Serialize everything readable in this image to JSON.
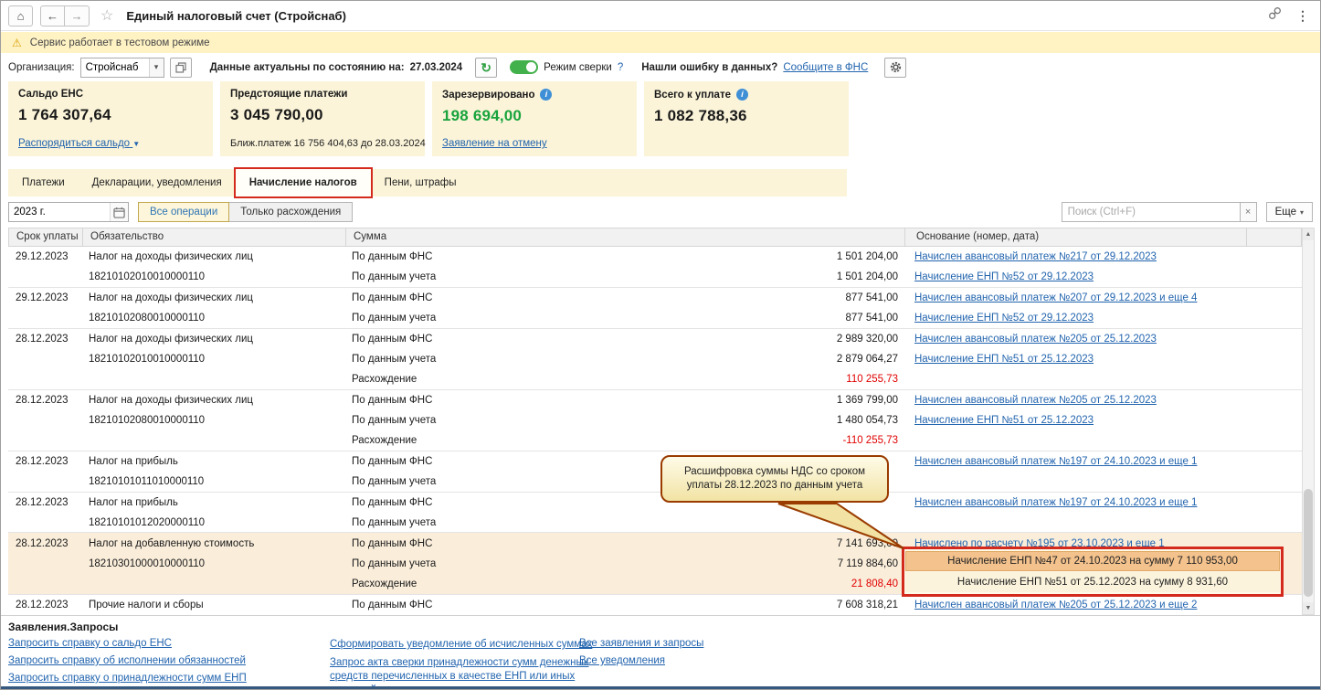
{
  "titlebar": {
    "title": "Единый налоговый счет (Стройснаб)"
  },
  "warning": {
    "text": "Сервис работает в тестовом режиме"
  },
  "toolbar": {
    "org_label": "Организация:",
    "org_value": "Стройснаб",
    "actuality_label": "Данные актуальны по состоянию на:",
    "actuality_date": "27.03.2024",
    "reconcile_label": "Режим сверки",
    "reconcile_help": "?",
    "error_prompt": "Нашли ошибку в данных?",
    "error_link": "Сообщите в ФНС"
  },
  "summary": {
    "balance": {
      "title": "Сальдо ЕНС",
      "value": "1 764 307,64",
      "link": "Распорядиться сальдо"
    },
    "upcoming": {
      "title": "Предстоящие платежи",
      "value": "3 045 790,00",
      "note": "Ближ.платеж 16 756 404,63 до 28.03.2024"
    },
    "reserved": {
      "title": "Зарезервировано",
      "value": "198 694,00",
      "link": "Заявление на отмену"
    },
    "total": {
      "title": "Всего к уплате",
      "value": "1 082 788,36"
    }
  },
  "tabs": {
    "payments": "Платежи",
    "declarations": "Декларации, уведомления",
    "accruals": "Начисление налогов",
    "penalties": "Пени, штрафы"
  },
  "filters": {
    "year": "2023 г.",
    "all_operations": "Все операции",
    "only_discrepancies": "Только расхождения",
    "search_placeholder": "Поиск (Ctrl+F)",
    "more": "Еще"
  },
  "table": {
    "headers": {
      "due": "Срок уплаты",
      "obligation": "Обязательство",
      "amount": "Сумма",
      "basis": "Основание (номер, дата)"
    },
    "rows": [
      {
        "date": "29.12.2023",
        "obligation": "Налог на доходы физических лиц",
        "kind": "По данным ФНС",
        "amount": "1 501 204,00",
        "red": false,
        "basis": "Начислен авансовый платеж №217 от 29.12.2023",
        "selected": false,
        "group_end": false
      },
      {
        "date": "",
        "obligation": "18210102010010000110",
        "kind": "По данным учета",
        "amount": "1 501 204,00",
        "red": false,
        "basis": "Начисление ЕНП №52 от 29.12.2023",
        "selected": false,
        "group_end": true
      },
      {
        "date": "29.12.2023",
        "obligation": "Налог на доходы физических лиц",
        "kind": "По данным ФНС",
        "amount": "877 541,00",
        "red": false,
        "basis": "Начислен авансовый платеж №207 от 29.12.2023 и еще 4",
        "selected": false,
        "group_end": false
      },
      {
        "date": "",
        "obligation": "18210102080010000110",
        "kind": "По данным учета",
        "amount": "877 541,00",
        "red": false,
        "basis": "Начисление ЕНП №52 от 29.12.2023",
        "selected": false,
        "group_end": true
      },
      {
        "date": "28.12.2023",
        "obligation": "Налог на доходы физических лиц",
        "kind": "По данным ФНС",
        "amount": "2 989 320,00",
        "red": false,
        "basis": "Начислен авансовый платеж №205 от 25.12.2023",
        "selected": false,
        "group_end": false
      },
      {
        "date": "",
        "obligation": "18210102010010000110",
        "kind": "По данным учета",
        "amount": "2 879 064,27",
        "red": false,
        "basis": "Начисление ЕНП №51 от 25.12.2023",
        "selected": false,
        "group_end": false
      },
      {
        "date": "",
        "obligation": "",
        "kind": "Расхождение",
        "amount": "110 255,73",
        "red": true,
        "basis": "",
        "selected": false,
        "group_end": true
      },
      {
        "date": "28.12.2023",
        "obligation": "Налог на доходы физических лиц",
        "kind": "По данным ФНС",
        "amount": "1 369 799,00",
        "red": false,
        "basis": "Начислен авансовый платеж №205 от 25.12.2023",
        "selected": false,
        "group_end": false
      },
      {
        "date": "",
        "obligation": "18210102080010000110",
        "kind": "По данным учета",
        "amount": "1 480 054,73",
        "red": false,
        "basis": "Начисление ЕНП №51 от 25.12.2023",
        "selected": false,
        "group_end": false
      },
      {
        "date": "",
        "obligation": "",
        "kind": "Расхождение",
        "amount": "-110 255,73",
        "red": true,
        "basis": "",
        "selected": false,
        "group_end": true
      },
      {
        "date": "28.12.2023",
        "obligation": "Налог на прибыль",
        "kind": "По данным ФНС",
        "amount": "",
        "red": false,
        "basis": "Начислен авансовый платеж №197 от 24.10.2023 и еще 1",
        "selected": false,
        "group_end": false
      },
      {
        "date": "",
        "obligation": "18210101011010000110",
        "kind": "По данным учета",
        "amount": "",
        "red": false,
        "basis": "",
        "selected": false,
        "group_end": true
      },
      {
        "date": "28.12.2023",
        "obligation": "Налог на прибыль",
        "kind": "По данным ФНС",
        "amount": "",
        "red": false,
        "basis": "Начислен авансовый платеж №197 от 24.10.2023 и еще 1",
        "selected": false,
        "group_end": false
      },
      {
        "date": "",
        "obligation": "18210101012020000110",
        "kind": "По данным учета",
        "amount": "",
        "red": false,
        "basis": "",
        "selected": false,
        "group_end": true
      },
      {
        "date": "28.12.2023",
        "obligation": "Налог на добавленную стоимость",
        "kind": "По данным ФНС",
        "amount": "7 141 693,00",
        "red": false,
        "basis": "Начислено по расчету №195 от 23.10.2023 и еще 1",
        "selected": true,
        "group_end": false
      },
      {
        "date": "",
        "obligation": "18210301000010000110",
        "kind": "По данным учета",
        "amount": "7 119 884,60",
        "red": false,
        "basis": "",
        "selected": true,
        "group_end": false
      },
      {
        "date": "",
        "obligation": "",
        "kind": "Расхождение",
        "amount": "21 808,40",
        "red": true,
        "basis": "",
        "selected": true,
        "group_end": true
      },
      {
        "date": "28.12.2023",
        "obligation": "Прочие налоги и сборы",
        "kind": "По данным ФНС",
        "amount": "7 608 318,21",
        "red": false,
        "basis": "Начислен авансовый платеж №205 от 25.12.2023 и еще 2",
        "selected": false,
        "group_end": false
      }
    ]
  },
  "callout": {
    "text": "Расшифровка суммы НДС со сроком уплаты 28.12.2023 по данным учета"
  },
  "popup": {
    "items": [
      {
        "text": "Начисление ЕНП №47 от 24.10.2023 на сумму 7 110 953,00",
        "highlighted": true
      },
      {
        "text": "Начисление ЕНП №51 от 25.12.2023 на сумму 8 931,60",
        "highlighted": false
      }
    ]
  },
  "requests": {
    "title": "Заявления.Запросы",
    "col1": [
      "Запросить справку о сальдо ЕНС",
      "Запросить справку об исполнении обязанностей",
      "Запросить справку о принадлежности сумм ЕНП"
    ],
    "col2": [
      "Сформировать уведомление об исчисленных суммах",
      "Запрос акта сверки принадлежности сумм денежных средств перечисленных в качестве ЕНП или иных платежей"
    ],
    "col3": [
      "Все заявления и запросы",
      "Все уведомления"
    ]
  },
  "icons": {
    "home": "⌂",
    "back": "←",
    "forward": "→",
    "star": "☆",
    "menu": "⋮",
    "warning": "⚠",
    "refresh": "↻",
    "caret_down": "▾",
    "link_arrow": "▼",
    "clear": "×",
    "info": "i",
    "scroll_up": "▲",
    "scroll_down": "▼"
  },
  "colors": {
    "accent_link": "#2264AE",
    "warning_bg": "#FFF3C4",
    "panel_bg": "#FBF4D9",
    "reserved_green": "#18A33C",
    "discrepancy_red": "#E00000",
    "annotation_red": "#D42A1E",
    "selected_row_bg": "#FAEEDB",
    "popup_highlight": "#F3C28D"
  }
}
